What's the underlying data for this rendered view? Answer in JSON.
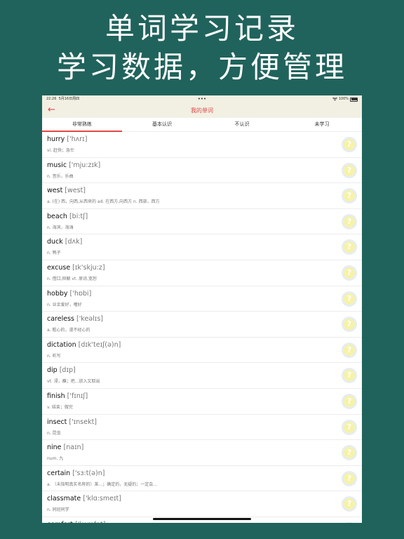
{
  "promo": {
    "line1": "单词学习记录",
    "line2": "学习数据，方便管理"
  },
  "status": {
    "time": "22:26",
    "date": "5月16日周四",
    "dots": "•••",
    "wifi": "wifi-icon",
    "battery": "100%"
  },
  "nav": {
    "back": "←",
    "title": "我的单词"
  },
  "tabs": [
    "非常熟练",
    "基本认识",
    "不认识",
    "未学习"
  ],
  "words": [
    {
      "word": "hurry",
      "phonetic": "['hʌrɪ]",
      "meaning": "vi. 赶快；急忙"
    },
    {
      "word": "music",
      "phonetic": "['mju:zɪk]",
      "meaning": "n. 音乐，乐曲"
    },
    {
      "word": "west",
      "phonetic": "[west]",
      "meaning": "a. (在) 西，向西,从西来的 ad. 在西方,向西方 n. 西部，西方"
    },
    {
      "word": "beach",
      "phonetic": "[bi:tʃ]",
      "meaning": "n. 海滨，海滩"
    },
    {
      "word": "duck",
      "phonetic": "[dʌk]",
      "meaning": "n. 鸭子"
    },
    {
      "word": "excuse",
      "phonetic": "[ɪk'skju:z]",
      "meaning": "n. 借口,辩解 vt. 原谅,宽恕"
    },
    {
      "word": "hobby",
      "phonetic": "['hɒbi]",
      "meaning": "n. 业余爱好，嗜好"
    },
    {
      "word": "careless",
      "phonetic": "['keəlɪs]",
      "meaning": "a. 粗心的，漫不经心的"
    },
    {
      "word": "dictation",
      "phonetic": "[dɪk'teɪʃ(ə)n]",
      "meaning": "n. 听写"
    },
    {
      "word": "dip",
      "phonetic": "[dɪp]",
      "meaning": "vt. 浸，蘸；把...放入又取出"
    },
    {
      "word": "finish",
      "phonetic": "['fɪnɪʃ]",
      "meaning": "v. 结束；做完"
    },
    {
      "word": "insect",
      "phonetic": "['ɪnsekt]",
      "meaning": "n. 昆虫"
    },
    {
      "word": "nine",
      "phonetic": "[naɪn]",
      "meaning": "num. 九"
    },
    {
      "word": "certain",
      "phonetic": "['sɜ:t(ə)n]",
      "meaning": "a. （未指明真实名称的）某...；确定的，无疑的；一定会..."
    },
    {
      "word": "classmate",
      "phonetic": "['klɑ:smeɪt]",
      "meaning": "n. 同班同学"
    },
    {
      "word": "comfort",
      "phonetic": "['kʌmfət]",
      "meaning": ""
    }
  ],
  "button_glyph": "?"
}
